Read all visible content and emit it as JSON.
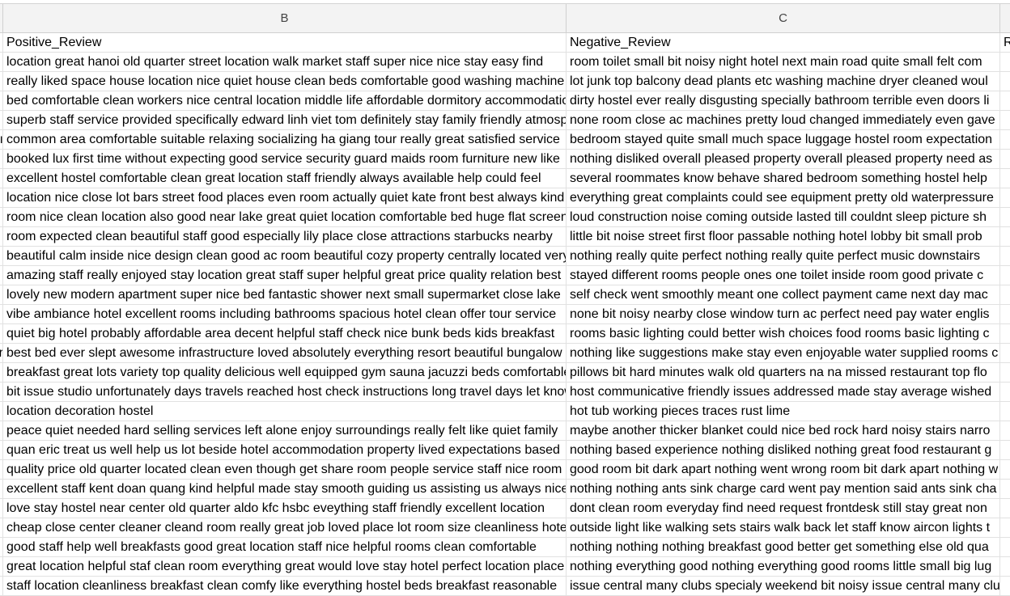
{
  "columns": {
    "b": "B",
    "c": "C"
  },
  "headers": {
    "b": "Positive_Review",
    "c": "Negative_Review",
    "d": "R"
  },
  "rows": [
    {
      "a": "",
      "b": "location great hanoi old quarter street location walk market staff super nice nice stay easy find",
      "c": "room toilet small bit noisy night hotel next main road quite small felt com"
    },
    {
      "a": "",
      "b": "really liked space house location nice quiet house clean beds comfortable good washing machine",
      "c": "lot junk top balcony dead plants etc washing machine dryer cleaned woul"
    },
    {
      "a": "",
      "b": "bed comfortable clean workers nice central location middle life affordable dormitory accommodation",
      "c": "dirty hostel ever really disgusting specially bathroom terrible even doors li"
    },
    {
      "a": "",
      "b": "superb staff service provided specifically edward linh viet tom definitely stay family friendly atmosphere",
      "c": "none room close ac machines pretty loud changed immediately even gave"
    },
    {
      "a": "ı",
      "b": "common area comfortable suitable relaxing socializing ha giang tour really great satisfied service",
      "c": "bedroom stayed quite small much space luggage hostel room expectation"
    },
    {
      "a": "",
      "b": "booked lux first time without expecting good service security guard maids room furniture new like",
      "c": "nothing disliked overall pleased property overall pleased property need as"
    },
    {
      "a": "",
      "b": "excellent hostel comfortable clean great location staff friendly always available help could feel",
      "c": "several roommates know behave shared bedroom something hostel help"
    },
    {
      "a": "",
      "b": "location nice close lot bars street food places even room actually quiet kate front best always kind",
      "c": "everything great complaints could see equipment pretty old waterpressure"
    },
    {
      "a": "",
      "b": "room nice clean location also good near lake great quiet location comfortable bed huge flat screen",
      "c": "loud construction noise coming outside lasted till couldnt sleep picture sh"
    },
    {
      "a": "",
      "b": "room expected clean beautiful staff good especially lily place close attractions starbucks nearby",
      "c": "little bit noise street first floor passable nothing hotel lobby bit small prob"
    },
    {
      "a": "",
      "b": "beautiful calm inside nice design clean good ac room beautiful cozy property centrally located very",
      "c": "nothing really quite perfect nothing really quite perfect music downstairs"
    },
    {
      "a": "",
      "b": "amazing staff really enjoyed stay location great staff super helpful great price quality relation best",
      "c": "stayed different rooms people ones one toilet inside room good private c"
    },
    {
      "a": "",
      "b": "lovely new modern apartment super nice bed fantastic shower next small supermarket close lake",
      "c": "self check went smoothly meant one collect payment came next day mac"
    },
    {
      "a": "",
      "b": "vibe ambiance hotel excellent rooms including bathrooms spacious hotel clean offer tour service",
      "c": "none bit noisy nearby close window turn ac perfect need pay water englis"
    },
    {
      "a": "",
      "b": "quiet big hotel probably affordable area decent helpful staff check nice bunk beds kids breakfast",
      "c": "rooms basic lighting could better wish choices food rooms basic lighting c"
    },
    {
      "a": "r",
      "b": "best bed ever slept awesome infrastructure loved absolutely everything resort beautiful bungalow",
      "c": "nothing like suggestions make stay even enjoyable water supplied rooms c"
    },
    {
      "a": "",
      "b": "breakfast great lots variety top quality delicious well equipped gym sauna jacuzzi beds comfortable",
      "c": "pillows bit hard minutes walk old quarters na na missed restaurant top flo"
    },
    {
      "a": "",
      "b": "bit issue studio unfortunately days travels reached host check instructions long travel days let know",
      "c": "host communicative friendly issues addressed made stay average wished"
    },
    {
      "a": "",
      "b": "location decoration hostel",
      "c": "hot tub working pieces traces rust lime"
    },
    {
      "a": "",
      "b": "peace quiet needed hard selling services left alone enjoy surroundings really felt like quiet family",
      "c": "maybe another thicker blanket could nice bed rock hard noisy stairs narro"
    },
    {
      "a": "",
      "b": "quan eric treat us well help us lot beside hotel accommodation property lived expectations based",
      "c": "nothing based experience nothing disliked nothing great food restaurant g"
    },
    {
      "a": "",
      "b": "quality price old quarter located clean even though get share room people service staff nice room",
      "c": "good room bit dark apart nothing went wrong room bit dark apart nothing w"
    },
    {
      "a": "",
      "b": "excellent staff kent doan quang kind helpful made stay smooth guiding us assisting us always nice",
      "c": "nothing nothing ants sink charge card went pay mention said ants sink cha"
    },
    {
      "a": "",
      "b": "love stay hostel near center old quarter aldo kfc hsbc eveything staff friendly excellent location",
      "c": "dont clean room everyday find need request frontdesk still stay great non"
    },
    {
      "a": "",
      "b": "cheap close center cleaner cleand room really great job loved place lot room size cleanliness hotel",
      "c": "outside light like walking sets stairs walk back let staff know aircon lights t"
    },
    {
      "a": "",
      "b": "good staff help well breakfasts good great location staff nice helpful rooms clean comfortable",
      "c": "nothing nothing nothing breakfast good better get something else old qua"
    },
    {
      "a": "",
      "b": "great location helpful staf clean room everything great would love stay hotel perfect location place",
      "c": "nothing everything good nothing everything good rooms little small big lug"
    },
    {
      "a": "",
      "b": "staff location cleanliness breakfast clean comfy like everything hostel beds breakfast reasonable",
      "c": "issue central many clubs specialy weekend bit noisy issue central many clu"
    }
  ]
}
